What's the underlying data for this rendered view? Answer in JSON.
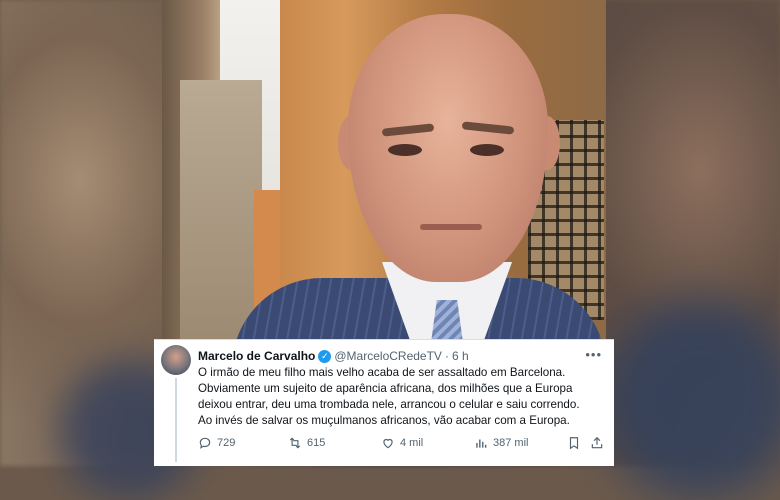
{
  "tweet": {
    "display_name": "Marcelo de Carvalho",
    "handle": "@MarceloCRedeTV",
    "time": "6 h",
    "more_icon": "more-horizontal-icon",
    "text_lines": [
      "O irmão de meu filho mais velho acaba de ser assaltado em Barcelona.",
      "Obviamente um sujeito de aparência africana, dos milhões que a Europa",
      "deixou entrar, deu uma trombada nele, arrancou o celular e saiu correndo.",
      "Ao invés de salvar os muçulmanos africanos, vão acabar com a Europa."
    ],
    "actions": {
      "replies": "729",
      "retweets": "615",
      "likes": "4 mil",
      "views": "387 mil"
    },
    "verified_color": "#1d9bf0"
  }
}
